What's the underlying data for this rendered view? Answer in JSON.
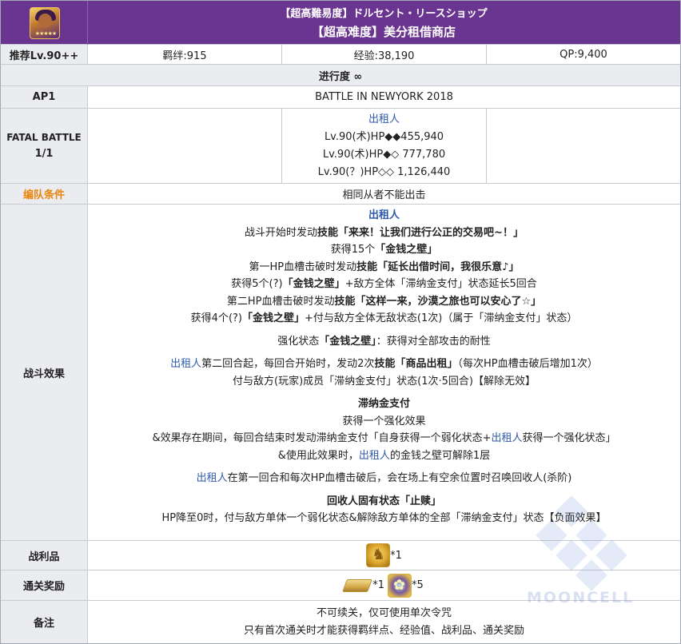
{
  "header": {
    "jp_title": "【超高難易度】ドルセント・リースショップ",
    "cn_title": "【超高难度】美分租借商店"
  },
  "info_row": {
    "level": "推荐Lv.90++",
    "bond": "羁绊:915",
    "exp": "经验:38,190",
    "qp": "QP:9,400"
  },
  "progress": "进行度 ∞",
  "ap": {
    "label": "AP1",
    "value": "BATTLE IN NEWYORK 2018"
  },
  "fatal": {
    "label1": "FATAL BATTLE",
    "label2": "1/1",
    "enemy_name": "出租人",
    "hp_lines": [
      "Lv.90(术)HP◆◆455,940",
      "Lv.90(术)HP◆◇ 777,780",
      "Lv.90(？)HP◇◇ 1,126,440"
    ]
  },
  "formation": {
    "label": "编队条件",
    "value": "相同从者不能出击"
  },
  "battle": {
    "label": "战斗效果",
    "name": "出租人",
    "l1a": "战斗开始时发动",
    "l1b": "技能「来来！让我们进行公正的交易吧~！」",
    "l2a": "获得15个",
    "l2b": "「金钱之壁」",
    "l3a": "第一HP血槽击破时发动",
    "l3b": "技能「延长出借时间，我很乐意♪」",
    "l4a": "获得5个(?)",
    "l4b": "「金钱之壁」",
    "l4c": "+敌方全体「滞纳金支付」状态延长5回合",
    "l5a": "第二HP血槽击破时发动",
    "l5b": "技能「这样一来，沙漠之旅也可以安心了☆」",
    "l6a": "获得4个(?)",
    "l6b": "「金钱之壁」",
    "l6c": "+付与敌方全体无敌状态(1次)（属于「滞纳金支付」状态）",
    "l7a": "强化状态",
    "l7b": "「金钱之壁」",
    "l7c": "：获得对全部攻击的耐性",
    "l8a": "出租人",
    "l8b": "第二回合起，每回合开始时，发动2次",
    "l8c": "技能「商品出租」",
    "l8d": "（每次HP血槽击破后增加1次）",
    "l9": "付与敌方(玩家)成员「滞纳金支付」状态(1次·5回合)【解除无效】",
    "l10": "滞纳金支付",
    "l11": "获得一个强化效果",
    "l12a": "&效果存在期间，每回合结束时发动滞纳金支付「自身获得一个弱化状态+",
    "l12b": "出租人",
    "l12c": "获得一个强化状态」",
    "l13a": "&使用此效果时，",
    "l13b": "出租人",
    "l13c": "的金钱之壁可解除1层",
    "l14a": "出租人",
    "l14b": "在第一回合和每次HP血槽击破后，会在场上有空余位置时召唤回收人(杀阶)",
    "l15": "回收人固有状态「止赎」",
    "l16": "HP降至0时，付与敌方单体一个弱化状态&解除敌方单体的全部「滞纳金支付」状态【负面效果】"
  },
  "drops": {
    "label": "战利品",
    "count": "*1",
    "icon": "gold-figure-icon"
  },
  "rewards": {
    "label": "通关奖励",
    "count1": "*1",
    "count2": "*5",
    "icon1": "gold-ingot-icon",
    "icon2": "craft-essence-icon"
  },
  "notes": {
    "label": "备注",
    "line1": "不可续关，仅可使用单次令咒",
    "line2": "只有首次通关时才能获得羁绊点、经验值、战利品、通关奖励"
  },
  "watermark": "MOONCELL",
  "colors": {
    "header_bg": "#6a3590",
    "label_bg": "#eaecf0",
    "accent_orange": "#e8850c",
    "link_blue": "#2e5aa8",
    "border": "#c8ccd1"
  }
}
